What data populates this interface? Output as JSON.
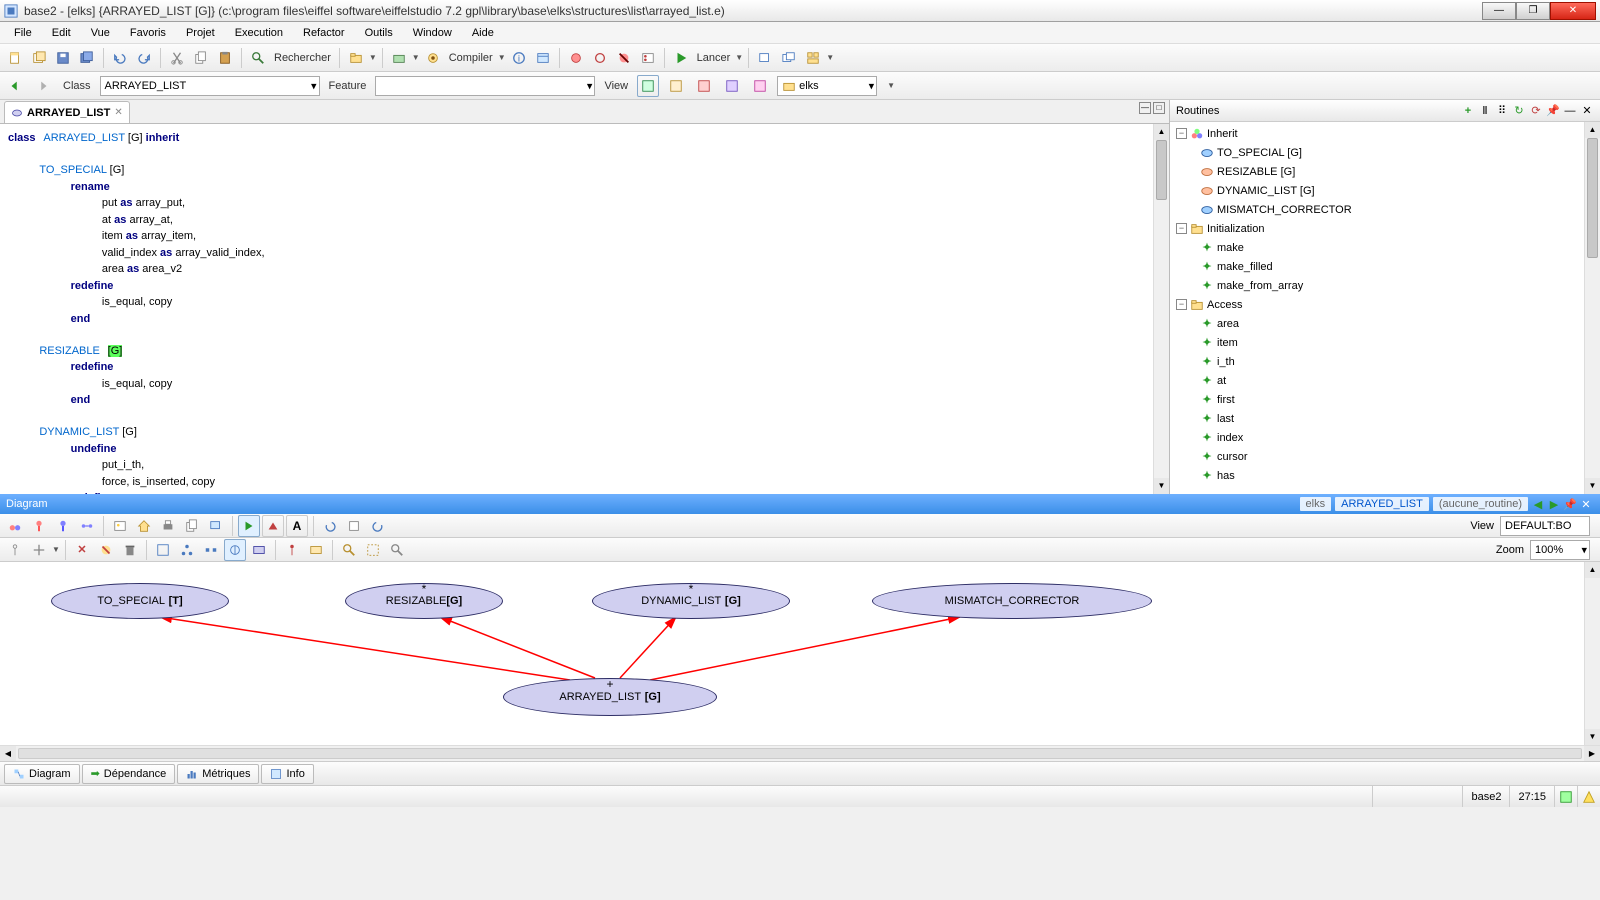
{
  "window": {
    "title": "base2 - [elks] {ARRAYED_LIST [G]} (c:\\program files\\eiffel software\\eiffelstudio 7.2 gpl\\library\\base\\elks\\structures\\list\\arrayed_list.e)"
  },
  "menu": [
    "File",
    "Edit",
    "Vue",
    "Favoris",
    "Projet",
    "Execution",
    "Refactor",
    "Outils",
    "Window",
    "Aide"
  ],
  "toolbar": {
    "search_label": "Rechercher",
    "compile_label": "Compiler",
    "run_label": "Lancer"
  },
  "addressbar": {
    "class_label": "Class",
    "class_value": "ARRAYED_LIST",
    "feature_label": "Feature",
    "feature_value": "",
    "view_label": "View",
    "cluster_value": "elks"
  },
  "tab": {
    "label": "ARRAYED_LIST"
  },
  "routines": {
    "title": "Routines",
    "inherit": {
      "label": "Inherit",
      "items": [
        "TO_SPECIAL [G]",
        "RESIZABLE [G]",
        "DYNAMIC_LIST [G]",
        "MISMATCH_CORRECTOR"
      ]
    },
    "initialization": {
      "label": "Initialization",
      "items": [
        "make",
        "make_filled",
        "make_from_array"
      ]
    },
    "access": {
      "label": "Access",
      "items": [
        "area",
        "item",
        "i_th",
        "at",
        "first",
        "last",
        "index",
        "cursor",
        "has"
      ]
    }
  },
  "diagram": {
    "title": "Diagram",
    "chips": {
      "cluster": "elks",
      "class": "ARRAYED_LIST",
      "routine": "(aucune_routine)"
    },
    "view_label": "View",
    "view_value": "DEFAULT:BO",
    "zoom_label": "Zoom",
    "zoom_value": "100%",
    "nodes": {
      "to_special": "TO_SPECIAL",
      "to_special_g": "[T]",
      "resizable": "RESIZABLE",
      "resizable_g": "[G]",
      "dynamic_list": "DYNAMIC_LIST",
      "dynamic_list_g": "[G]",
      "mismatch": "MISMATCH_CORRECTOR",
      "arrayed_list": "ARRAYED_LIST",
      "arrayed_list_g": "[G]"
    }
  },
  "bottom_tabs": [
    "Diagram",
    "Dépendance",
    "Métriques",
    "Info"
  ],
  "status": {
    "project": "base2",
    "pos": "27:15"
  },
  "code": {
    "line1_kw": "class",
    "line1_cls": "ARRAYED_LIST",
    "line1_rest": " [G] ",
    "line1_kw2": "inherit",
    "to_special": "TO_SPECIAL",
    "g": " [G]",
    "rename": "rename",
    "r1a": "put ",
    "r1b": "as",
    "r1c": " array_put,",
    "r2a": "at ",
    "r2c": " array_at,",
    "r3a": "item ",
    "r3c": " array_item,",
    "r4a": "valid_index ",
    "r4c": " array_valid_index,",
    "r5a": "area ",
    "r5c": " area_v2",
    "redefine": "redefine",
    "rd1": "is_equal, copy",
    "end": "end",
    "resizable": "RESIZABLE",
    "res_g": "[G]",
    "dynamic": "DYNAMIC_LIST",
    "undefine": "undefine",
    "ud1": "put_i_th,",
    "ud2": "force, is_inserted, copy"
  }
}
